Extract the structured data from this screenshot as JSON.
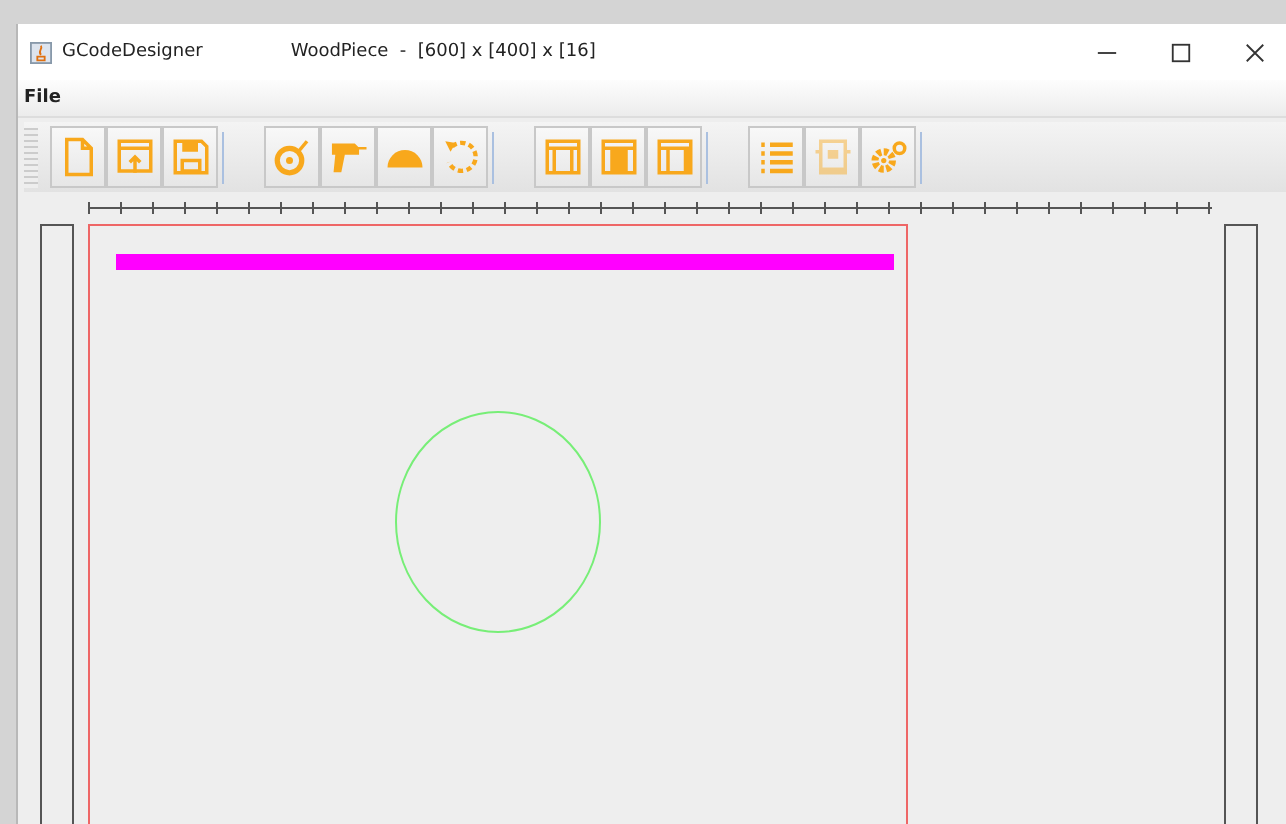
{
  "app_title": "GCodeDesigner",
  "window": {
    "title": "WoodPiece  -  [600] x [400] x [16]"
  },
  "menu": [
    "File"
  ],
  "toolbar_groups": [
    [
      {
        "kind": "new",
        "disabled": false
      },
      {
        "kind": "open",
        "disabled": false
      },
      {
        "kind": "save",
        "disabled": false
      }
    ],
    [
      {
        "kind": "measure",
        "disabled": false
      },
      {
        "kind": "drill",
        "disabled": false
      },
      {
        "kind": "protractor",
        "disabled": false
      },
      {
        "kind": "rotate",
        "disabled": false
      }
    ],
    [
      {
        "kind": "frame",
        "disabled": false
      },
      {
        "kind": "frame-filled",
        "disabled": false
      },
      {
        "kind": "frame-side",
        "disabled": false
      }
    ],
    [
      {
        "kind": "list",
        "disabled": false
      },
      {
        "kind": "machine",
        "disabled": true
      },
      {
        "kind": "gears",
        "disabled": false
      }
    ]
  ],
  "shapes": [
    {
      "kind": "bar",
      "color": "#ff00ff"
    },
    {
      "kind": "circle",
      "color": "#77ee77"
    }
  ]
}
